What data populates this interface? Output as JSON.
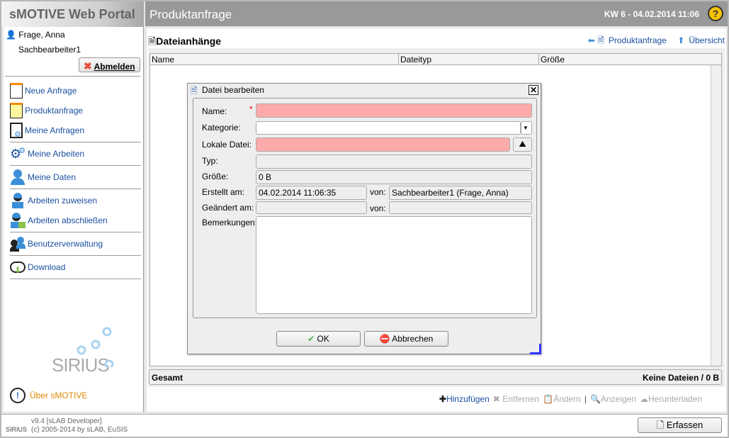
{
  "app": {
    "title": "sMOTIVE Web Portal",
    "page_title": "Produktanfrage",
    "datetime": "KW 6 - 04.02.2014 11:06",
    "help_icon": "help-icon"
  },
  "user": {
    "name": "Frage, Anna",
    "role": "Sachbearbeiter1",
    "logout": "Abmelden"
  },
  "nav": [
    {
      "label": "Neue Anfrage",
      "icon": "new-document-icon"
    },
    {
      "label": "Produktanfrage",
      "icon": "product-request-icon"
    },
    {
      "label": "Meine Anfragen",
      "icon": "document-gear-icon"
    },
    {
      "label": "Meine Arbeiten",
      "icon": "gears-icon"
    },
    {
      "label": "Meine Daten",
      "icon": "user-icon"
    },
    {
      "label": "Arbeiten zuweisen",
      "icon": "worker-icon"
    },
    {
      "label": "Arbeiten abschließen",
      "icon": "worker-done-icon"
    },
    {
      "label": "Benutzerverwaltung",
      "icon": "users-icon"
    },
    {
      "label": "Download",
      "icon": "cloud-download-icon"
    }
  ],
  "about": "Über sMOTIVE",
  "logo": "SIRIUS",
  "footer": {
    "version": "v9.4 [sLAB Developer]",
    "copyright": "(c) 2005-2014 by sLAB, EuSIS",
    "erfassen": "Erfassen"
  },
  "section": {
    "title": "Dateianhänge",
    "link_back": "Produktanfrage",
    "link_overview": "Übersicht"
  },
  "table": {
    "columns": [
      "Name",
      "Dateityp",
      "Größe"
    ],
    "rows": []
  },
  "summary": {
    "label": "Gesamt",
    "value": "Keine Dateien / 0 B"
  },
  "toolbar": {
    "add": "Hinzufügen",
    "remove": "Entfernen",
    "edit": "Ändern",
    "view": "Anzeigen",
    "download": "Herunterladen"
  },
  "dialog": {
    "title": "Datei bearbeiten",
    "name_label": "Name:",
    "name_value": "",
    "category_label": "Kategorie:",
    "category_value": "",
    "local_file_label": "Lokale Datei:",
    "local_file_value": "",
    "type_label": "Typ:",
    "type_value": "",
    "size_label": "Größe:",
    "size_value": "0 B",
    "created_label": "Erstellt am:",
    "created_value": "04.02.2014 11:06:35",
    "by_label": "von:",
    "created_by": "Sachbearbeiter1 (Frage, Anna)",
    "changed_label": "Geändert am:",
    "changed_value": "",
    "changed_by": "",
    "remarks_label": "Bemerkungen:",
    "remarks_value": "",
    "ok": "OK",
    "cancel": "Abbrechen"
  }
}
